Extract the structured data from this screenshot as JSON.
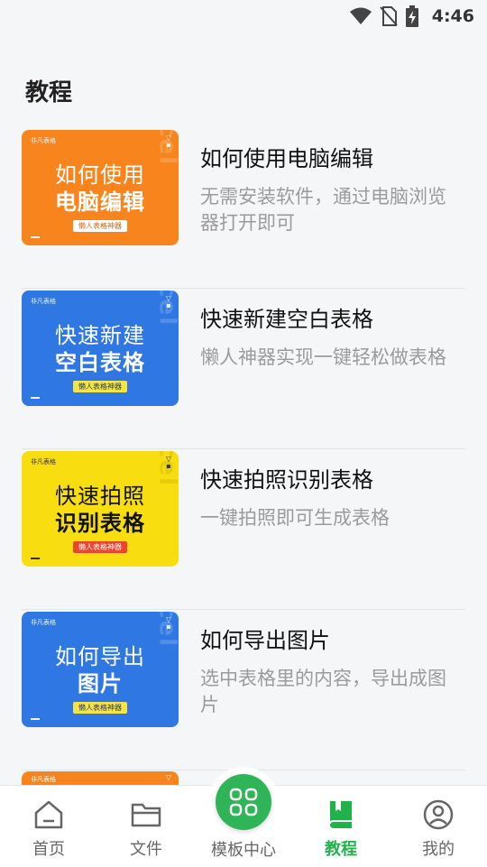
{
  "status_bar": {
    "time": "4:46",
    "icons": [
      "wifi-icon",
      "no-sim-icon",
      "battery-charging-icon"
    ]
  },
  "page_title": "教程",
  "tutorials": [
    {
      "title": "如何使用电脑编辑",
      "desc": "无需安装软件，通过电脑浏览器打开即可",
      "thumb": {
        "line1": "如何使用",
        "line2": "电脑编辑",
        "tag": "懒人表格神器",
        "brand": "非凡表格",
        "watermark": "excel",
        "color": "#f7841d"
      }
    },
    {
      "title": "快速新建空白表格",
      "desc": "懒人神器实现一键轻松做表格",
      "thumb": {
        "line1": "快速新建",
        "line2": "空白表格",
        "tag": "懒人表格神器",
        "brand": "非凡表格",
        "watermark": "excel",
        "color": "#2f77e2"
      }
    },
    {
      "title": "快速拍照识别表格",
      "desc": "一键拍照即可生成表格",
      "thumb": {
        "line1": "快速拍照",
        "line2": "识别表格",
        "tag": "懒人表格神器",
        "brand": "非凡表格",
        "watermark": "excel",
        "color": "#f8de10"
      }
    },
    {
      "title": "如何导出图片",
      "desc": "选中表格里的内容，导出成图片",
      "thumb": {
        "line1": "如何导出",
        "line2": "图片",
        "tag": "懒人表格神器",
        "brand": "非凡表格",
        "watermark": "excel",
        "color": "#2f77e2"
      }
    }
  ],
  "partial_item": {
    "brand": "非凡表格"
  },
  "tab_bar": {
    "tabs": [
      {
        "label": "首页",
        "icon": "home-icon"
      },
      {
        "label": "文件",
        "icon": "folder-icon"
      },
      {
        "label": "模板中心",
        "icon": "grid-icon"
      },
      {
        "label": "教程",
        "icon": "book-icon",
        "active": true
      },
      {
        "label": "我的",
        "icon": "profile-icon"
      }
    ],
    "active_color": "#22b24c",
    "center_color": "#2fb457"
  }
}
